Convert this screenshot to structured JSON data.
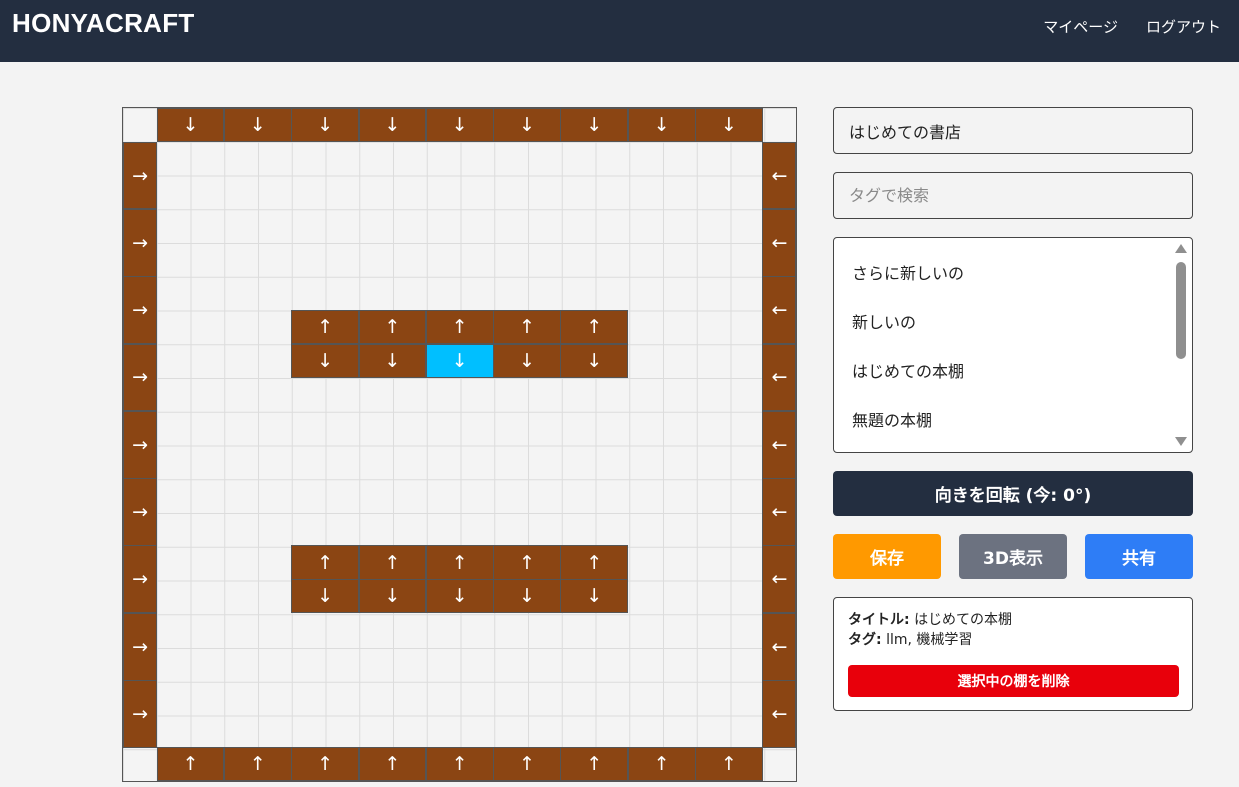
{
  "header": {
    "logo": "HONYACRAFT",
    "nav": [
      "マイページ",
      "ログアウト"
    ]
  },
  "store_name": "はじめての書店",
  "tag_search": {
    "placeholder": "タグで検索",
    "value": ""
  },
  "shelf_list": [
    "さらに新しいの",
    "新しいの",
    "はじめての本棚",
    "無題の本棚"
  ],
  "rotate_button": "向きを回転 (今: 0°)",
  "actions": {
    "save": "保存",
    "view3d": "3D表示",
    "share": "共有"
  },
  "selected_info": {
    "title_label": "タイトル:",
    "title_value": "はじめての本棚",
    "tags_label": "タグ:",
    "tags_value": "llm, 機械学習",
    "delete_button": "選択中の棚を削除"
  },
  "arrows": {
    "up": "↑",
    "down": "↓",
    "left": "←",
    "right": "→"
  },
  "colors": {
    "header_bg": "#232e40",
    "shelf": "#8b4513",
    "shelf_selected": "#00bfff",
    "rotate_btn": "#232e40",
    "save_btn": "#ff9900",
    "view3d_btn": "#6c7280",
    "share_btn": "#2e7df6",
    "delete_btn": "#e8000b"
  }
}
